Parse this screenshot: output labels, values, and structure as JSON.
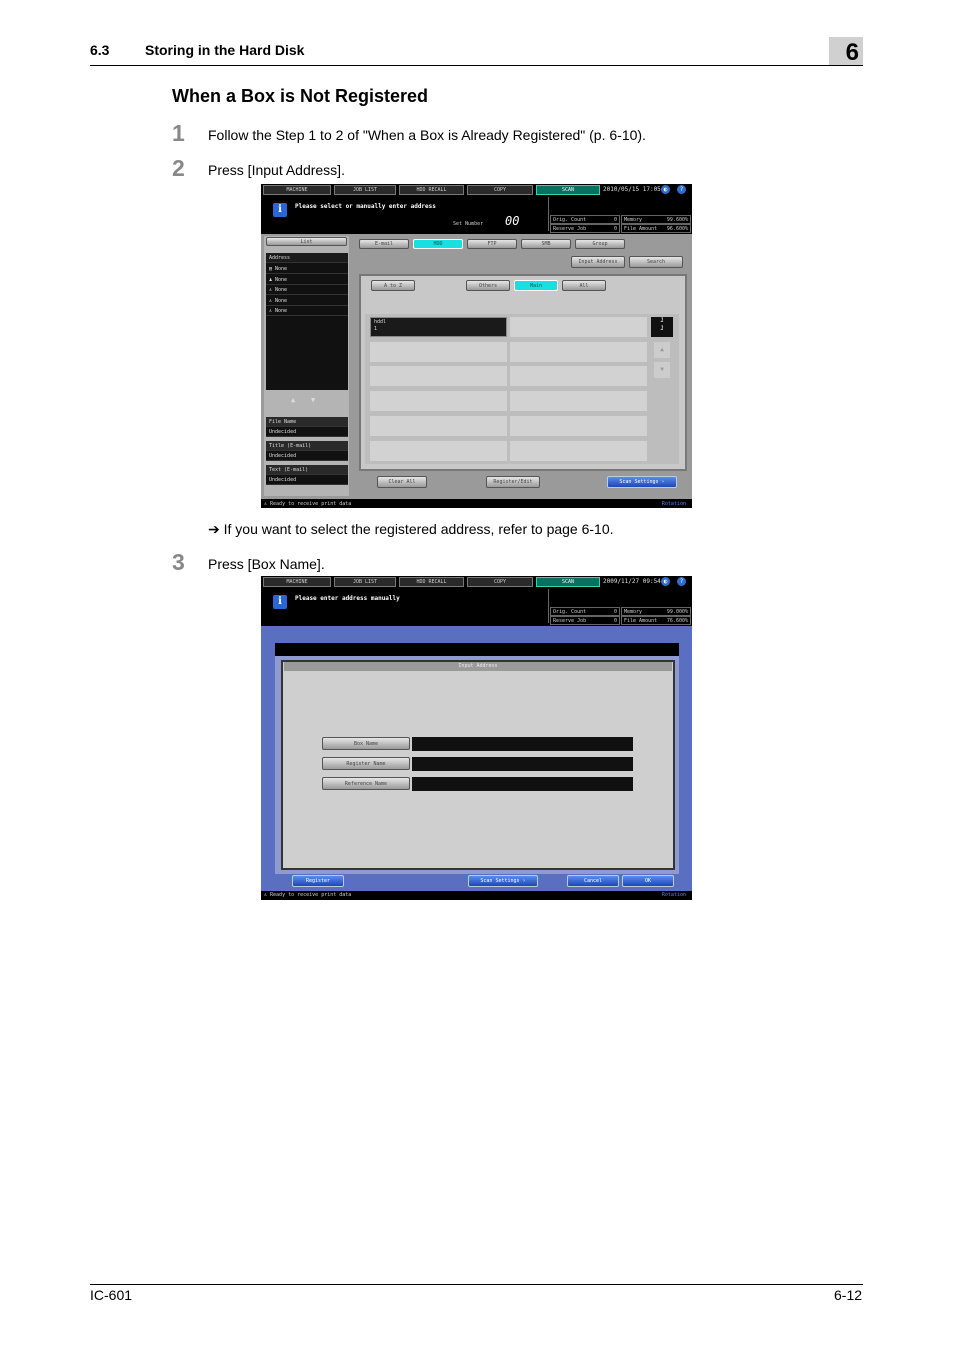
{
  "header": {
    "section_number": "6.3",
    "section_title": "Storing in the Hard Disk",
    "chapter": "6"
  },
  "section_heading": "When a Box is Not Registered",
  "steps": [
    {
      "num": "1",
      "text": "Follow the Step 1 to 2 of \"When a Box is Already Registered\" (p. 6-10)."
    },
    {
      "num": "2",
      "text": "Press [Input Address]."
    },
    {
      "num": "3",
      "text": "Press [Box Name]."
    }
  ],
  "note": "➔  If you want to select the registered address, refer to page 6-10.",
  "screen1": {
    "tabs": [
      "MACHINE",
      "JOB LIST",
      "HDD RECALL",
      "COPY",
      "SCAN"
    ],
    "datetime": "2010/05/15 17:05",
    "message": "Please select or manually enter address",
    "set_number_label": "Set Number",
    "set_number": "00",
    "stats": [
      {
        "label": "Orig. Count",
        "value": "0"
      },
      {
        "label": "Memory",
        "value": "99.600%"
      },
      {
        "label": "Reserve Job",
        "value": "0"
      },
      {
        "label": "File Amount",
        "value": "96.600%"
      }
    ],
    "list_button": "List",
    "address_header": "Address",
    "address_items": [
      "None",
      "None",
      "None",
      "None",
      "None"
    ],
    "file_name_label": "File Name",
    "file_name_value": "Undecided",
    "title_label": "Title (E-mail)",
    "title_value": "Undecided",
    "text_label": "Text (E-mail)",
    "text_value": "Undecided",
    "dest_tabs": [
      "E-mail",
      "HDD",
      "FTP",
      "SMB",
      "Group"
    ],
    "input_address_button": "Input Address",
    "search_button": "Search",
    "index_buttons": [
      "A to Z",
      "Others",
      "Main",
      "All"
    ],
    "selected_entry_name": "hddl",
    "selected_entry_sub": "1",
    "page_indicator": "1\n1",
    "clear_all_button": "Clear All",
    "register_edit_button": "Register/Edit",
    "scan_settings_button": "Scan Settings",
    "status_text": "Ready to receive print data",
    "rotation_label": "Rotation"
  },
  "screen2": {
    "tabs": [
      "MACHINE",
      "JOB LIST",
      "HDD RECALL",
      "COPY",
      "SCAN"
    ],
    "datetime": "2009/11/27 09:54",
    "message": "Please enter address manually",
    "stats": [
      {
        "label": "Orig. Count",
        "value": "0"
      },
      {
        "label": "Memory",
        "value": "99.000%"
      },
      {
        "label": "Reserve Job",
        "value": "0"
      },
      {
        "label": "File Amount",
        "value": "76.600%"
      }
    ],
    "panel_title": "Input Address",
    "fields": [
      "Box Name",
      "Register Name",
      "Reference Name"
    ],
    "register_button": "Register",
    "scan_settings_button": "Scan Settings",
    "cancel_button": "Cancel",
    "ok_button": "OK",
    "status_text": "Ready to receive print data",
    "rotation_label": "Rotation"
  },
  "footer": {
    "left": "IC-601",
    "right": "6-12"
  }
}
